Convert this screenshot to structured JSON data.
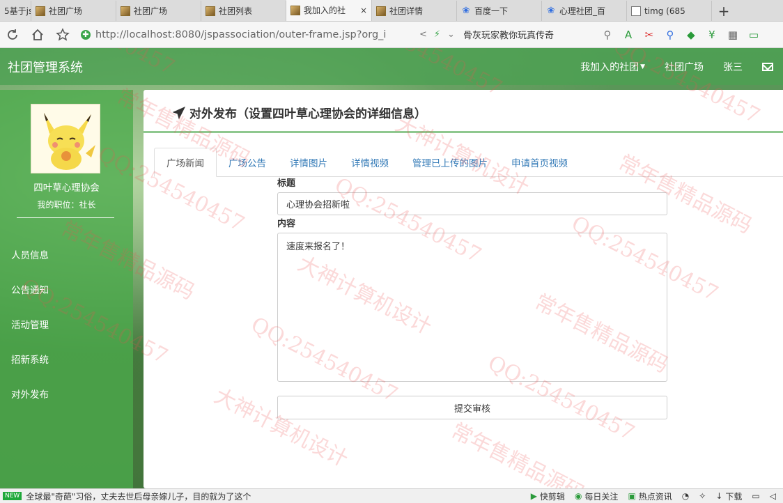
{
  "browser": {
    "tabs": [
      {
        "title": "5基于js",
        "icon": "none"
      },
      {
        "title": "社团广场",
        "icon": "site-icon"
      },
      {
        "title": "社团广场",
        "icon": "site-icon"
      },
      {
        "title": "社团列表",
        "icon": "site-icon"
      },
      {
        "title": "我加入的社",
        "icon": "site-icon",
        "active": true
      },
      {
        "title": "社团详情",
        "icon": "site-icon"
      },
      {
        "title": "百度一下",
        "icon": "baidu-paw-icon"
      },
      {
        "title": "心理社团_百",
        "icon": "baidu-paw-icon"
      },
      {
        "title": "timg (685",
        "icon": "document-icon"
      }
    ],
    "close_glyph": "×",
    "new_tab_glyph": "+",
    "url": "http://localhost:8080/jspassociation/outer-frame.jsp?org_i",
    "search_text": "骨灰玩家教你玩真传奇"
  },
  "app": {
    "brand": "社团管理系统",
    "nav": {
      "joined": "我加入的社团",
      "square": "社团广场",
      "user": "张三"
    },
    "sidebar": {
      "org_name": "四叶草心理协会",
      "position": "我的职位：社长",
      "menu": [
        "人员信息",
        "公告通知",
        "活动管理",
        "招新系统",
        "对外发布"
      ]
    },
    "panel": {
      "title": "对外发布（设置四叶草心理协会的详细信息）",
      "tabs": [
        "广场新闻",
        "广场公告",
        "详情图片",
        "详情视频",
        "管理已上传的图片",
        "申请首页视频"
      ],
      "form": {
        "title_label": "标题",
        "title_value": "心理协会招新啦",
        "content_label": "内容",
        "content_value": "速度来报名了！",
        "submit_label": "提交审核"
      }
    }
  },
  "watermarks": {
    "a": "QQ:254540457",
    "b": "常年售精品源码",
    "c": "大神计算机设计"
  },
  "statusbar": {
    "badge": "NEW",
    "news": "全球最\"奇葩\"习俗，丈夫去世后母亲嫁儿子，目的就为了这个",
    "tools": [
      "快剪辑",
      "每日关注",
      "热点资讯",
      "下载"
    ]
  }
}
